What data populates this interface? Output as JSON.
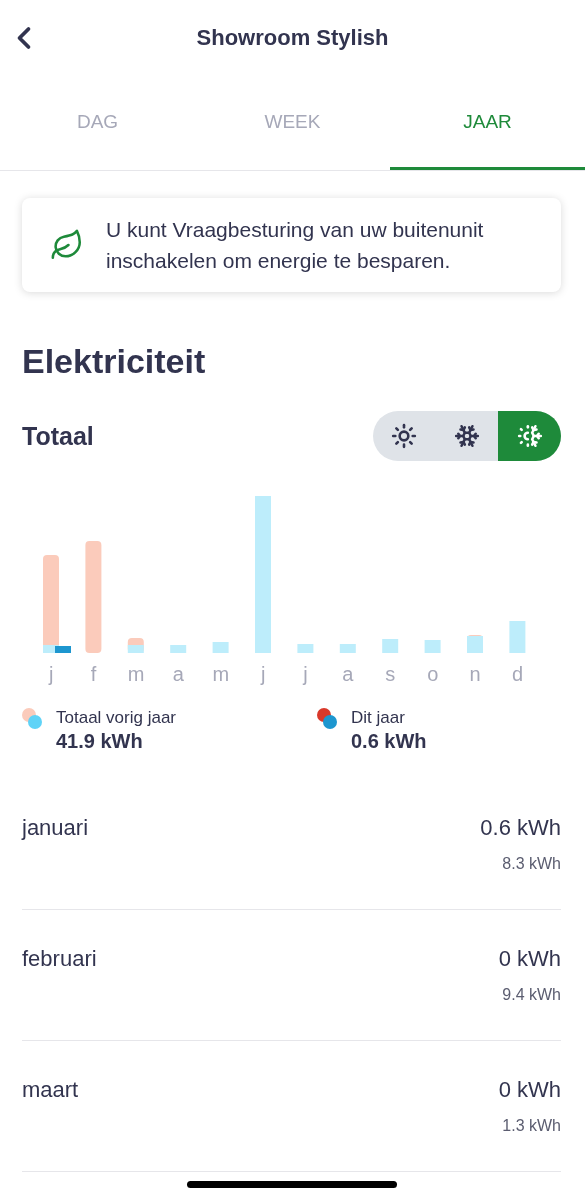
{
  "header": {
    "title": "Showroom Stylish"
  },
  "tabs": [
    {
      "label": "DAG",
      "selected": false
    },
    {
      "label": "WEEK",
      "selected": false
    },
    {
      "label": "JAAR",
      "selected": true
    }
  ],
  "notice": {
    "text": "U kunt Vraagbesturing van uw buitenunit inschakelen om energie te besparen."
  },
  "section_title": "Elektriciteit",
  "subtitle": "Totaal",
  "modes": [
    {
      "kind": "heat",
      "selected": false
    },
    {
      "kind": "cool",
      "selected": false
    },
    {
      "kind": "both",
      "selected": true
    }
  ],
  "chart_months": [
    "j",
    "f",
    "m",
    "a",
    "m",
    "j",
    "j",
    "a",
    "s",
    "o",
    "n",
    "d"
  ],
  "legend": [
    {
      "label": "Totaal vorig jaar",
      "value": "41.9 kWh",
      "dots": [
        {
          "color": "#fbcbbb"
        },
        {
          "color": "#5fd3f7"
        }
      ]
    },
    {
      "label": "Dit jaar",
      "value": "0.6 kWh",
      "dots": [
        {
          "color": "#d9392b"
        },
        {
          "color": "#1d96cf"
        }
      ]
    }
  ],
  "months": [
    {
      "name": "januari",
      "value": "0.6 kWh",
      "previous": "8.3 kWh"
    },
    {
      "name": "februari",
      "value": "0 kWh",
      "previous": "9.4 kWh"
    },
    {
      "name": "maart",
      "value": "0 kWh",
      "previous": "1.3 kWh"
    }
  ]
}
